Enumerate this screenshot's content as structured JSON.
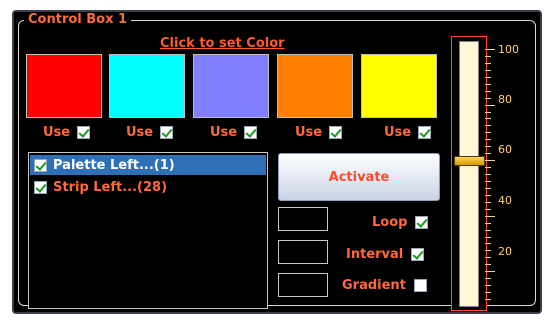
{
  "panel": {
    "title": "Control Box 1",
    "set_color_label": "Click to set Color"
  },
  "swatches": [
    {
      "color": "#ff0000",
      "use_label": "Use",
      "checked": true
    },
    {
      "color": "#00ffff",
      "use_label": "Use",
      "checked": true
    },
    {
      "color": "#8080ff",
      "use_label": "Use",
      "checked": true
    },
    {
      "color": "#ff8000",
      "use_label": "Use",
      "checked": true
    },
    {
      "color": "#ffff00",
      "use_label": "Use",
      "checked": true
    }
  ],
  "list": {
    "items": [
      {
        "label": "Palette Left...(1)",
        "checked": true,
        "selected": true
      },
      {
        "label": "Strip Left...(28)",
        "checked": true,
        "selected": false
      }
    ]
  },
  "actions": {
    "activate_label": "Activate"
  },
  "options": [
    {
      "label": "Loop",
      "checked": true
    },
    {
      "label": "Interval",
      "checked": true
    },
    {
      "label": "Gradient",
      "checked": false
    }
  ],
  "slider": {
    "value": 60,
    "min": 0,
    "max": 100,
    "labels": [
      "100",
      "80",
      "60",
      "40",
      "20"
    ]
  }
}
